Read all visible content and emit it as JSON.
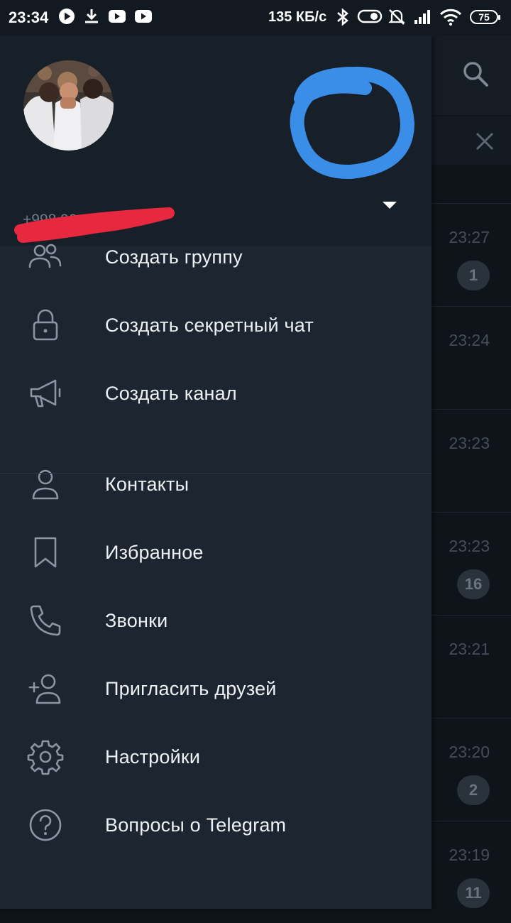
{
  "status_bar": {
    "time": "23:34",
    "network_speed": "135 КБ/с",
    "battery_level": "75",
    "icons": [
      "play-icon",
      "download-icon",
      "youtube-icon",
      "youtube-icon",
      "bluetooth-icon",
      "toggle-icon",
      "mute-icon",
      "signal-icon",
      "wifi-icon",
      "battery-icon"
    ]
  },
  "drawer": {
    "phone": "+998 90",
    "menu": [
      {
        "label": "Создать группу",
        "icon": "group-icon"
      },
      {
        "label": "Создать секретный чат",
        "icon": "lock-icon"
      },
      {
        "label": "Создать канал",
        "icon": "megaphone-icon"
      },
      {
        "label": "Контакты",
        "icon": "contact-icon"
      },
      {
        "label": "Избранное",
        "icon": "bookmark-icon"
      },
      {
        "label": "Звонки",
        "icon": "phone-icon"
      },
      {
        "label": "Пригласить друзей",
        "icon": "add-user-icon"
      },
      {
        "label": "Настройки",
        "icon": "gear-icon"
      },
      {
        "label": "Вопросы о Telegram",
        "icon": "help-icon"
      }
    ]
  },
  "background_chats": [
    {
      "time": "23:27",
      "badge": "1"
    },
    {
      "time": "23:24",
      "badge": ""
    },
    {
      "time": "23:23",
      "badge": ""
    },
    {
      "time": "23:23",
      "badge": "16"
    },
    {
      "time": "23:21",
      "badge": ""
    },
    {
      "time": "23:20",
      "badge": "2"
    },
    {
      "time": "23:19",
      "badge": "11"
    }
  ],
  "colors": {
    "drawer_bg": "#1d2530",
    "header_bg": "#171f29",
    "accent_scribble_blue": "#3b8ee8",
    "scribble_red": "#e8283e"
  }
}
